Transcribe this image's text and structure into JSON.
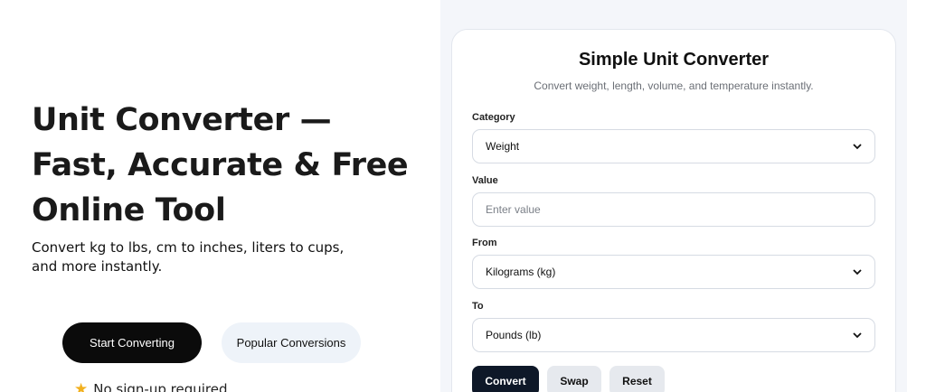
{
  "hero": {
    "title": "Unit Converter — Fast, Accurate & Free Online Tool",
    "subtitle": "Convert kg to lbs, cm to inches, liters to cups, and more instantly.",
    "primary_button": "Start Converting",
    "secondary_button": "Popular Conversions",
    "feature": "No sign-up required",
    "feature_icon": "star-icon"
  },
  "converter": {
    "title": "Simple Unit Converter",
    "subtitle": "Convert weight, length, volume, and temperature instantly.",
    "category": {
      "label": "Category",
      "value": "Weight"
    },
    "value": {
      "label": "Value",
      "placeholder": "Enter value"
    },
    "from": {
      "label": "From",
      "value": "Kilograms (kg)"
    },
    "to": {
      "label": "To",
      "value": "Pounds (lb)"
    },
    "buttons": {
      "convert": "Convert",
      "swap": "Swap",
      "reset": "Reset"
    }
  },
  "colors": {
    "primary_button_bg": "#0b0b0b",
    "secondary_button_bg": "#eef3f9",
    "panel_bg": "#f4f6fa",
    "convert_button_bg": "#0e1828",
    "secondary_action_bg": "#e6e9ee",
    "star": "#f2b01e"
  }
}
